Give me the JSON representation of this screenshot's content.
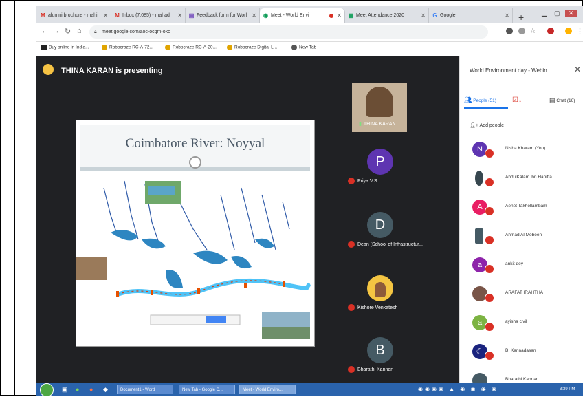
{
  "browser": {
    "tabs": [
      {
        "label": "alumni brochure - mahi",
        "icon": "M",
        "color": "#d93025"
      },
      {
        "label": "Inbox (7,085) - mahadi",
        "icon": "M",
        "color": "#d93025"
      },
      {
        "label": "Feedback form for Worl",
        "icon": "▤",
        "color": "#673ab7"
      },
      {
        "label": "Meet - World Envi",
        "icon": "◉",
        "color": "#0f9d58"
      },
      {
        "label": "Meet Attendance 2020",
        "icon": "▦",
        "color": "#0f9d58"
      },
      {
        "label": "Google",
        "icon": "G",
        "color": "#4285f4"
      }
    ],
    "url": "meet.google.com/aoc-ocgm-oko",
    "bookmarks": [
      "Buy online in India...",
      "Robocraze RC-A-72...",
      "Robocraze RC-A-20...",
      "Robocraze Digital L...",
      "New Tab"
    ]
  },
  "meet": {
    "presenter_text": "THINA KARAN is presenting",
    "slide_title": "Coimbatore River: Noyyal",
    "tiles": [
      {
        "name": "THINA KARAN",
        "initial": "",
        "color": "#8a6a4a"
      },
      {
        "name": "Priya V.S",
        "initial": "P",
        "color": "#5e35b1"
      },
      {
        "name": "Dean (School of Infrastructur...",
        "initial": "D",
        "color": "#455a64"
      },
      {
        "name": "Kishore Venkatesh",
        "initial": "",
        "color": "#f4c542"
      },
      {
        "name": "Bharathi Kannan",
        "initial": "B",
        "color": "#455a64"
      }
    ]
  },
  "panel": {
    "title": "World Environment day - Webin...",
    "tabs": {
      "people": "People (51)",
      "chat": "Chat (16)"
    },
    "add_people": "Add people",
    "participants": [
      {
        "name": "Nisha Kharam (You)",
        "initial": "N",
        "color": "#5e35b1"
      },
      {
        "name": "AbdulKalam ibn Haniffa",
        "initial": "",
        "color": "#37474f"
      },
      {
        "name": "Aenet Takhellambam",
        "initial": "A",
        "color": "#e91e63"
      },
      {
        "name": "Ahmad Al Mobeen",
        "initial": "",
        "color": "#455a64"
      },
      {
        "name": "ankit dey",
        "initial": "a",
        "color": "#8e24aa"
      },
      {
        "name": "ARAFAT IRAHTHA",
        "initial": "",
        "color": "#795548"
      },
      {
        "name": "ayisha civil",
        "initial": "a",
        "color": "#7cb342"
      },
      {
        "name": "B. Kannadasan",
        "initial": "",
        "color": "#1a237e"
      },
      {
        "name": "Bharathi Kannan",
        "initial": "",
        "color": "#455a64"
      }
    ]
  },
  "taskbar": {
    "items": [
      "Document1 - Word",
      "New Tab - Google C...",
      "Meet - World Enviro..."
    ],
    "time": "3:39 PM"
  }
}
